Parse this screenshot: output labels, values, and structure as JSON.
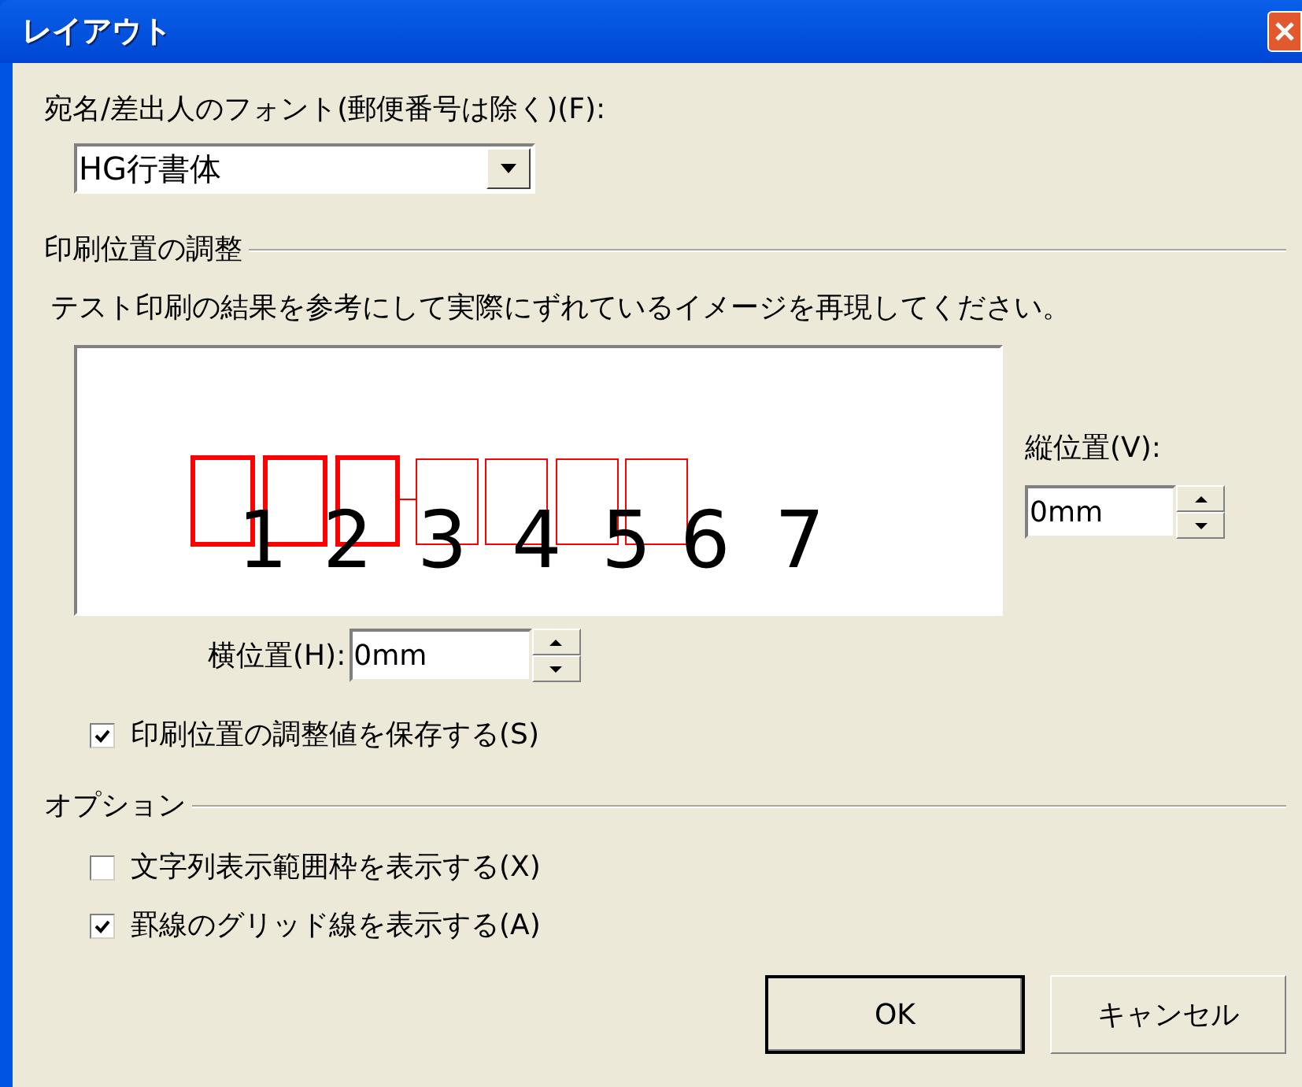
{
  "window": {
    "title": "レイアウト"
  },
  "font": {
    "label": "宛名/差出人のフォント(郵便番号は除く)(F):",
    "value": "HG行書体"
  },
  "position": {
    "group_title": "印刷位置の調整",
    "description": "テスト印刷の結果を参考にして実際にずれているイメージを再現してください。",
    "preview_digits": [
      "1",
      "2",
      "3",
      "4",
      "5",
      "6",
      "7"
    ],
    "vertical": {
      "label": "縦位置(V):",
      "value": "0mm"
    },
    "horizontal": {
      "label": "横位置(H):",
      "value": "0mm"
    },
    "save": {
      "label": "印刷位置の調整値を保存する(S)",
      "checked": true
    }
  },
  "options": {
    "group_title": "オプション",
    "items": [
      {
        "label": "文字列表示範囲枠を表示する(X)",
        "checked": false
      },
      {
        "label": "罫線のグリッド線を表示する(A)",
        "checked": true
      }
    ]
  },
  "buttons": [
    {
      "label": "OK",
      "default": true
    },
    {
      "label": "キャンセル",
      "default": false
    }
  ]
}
